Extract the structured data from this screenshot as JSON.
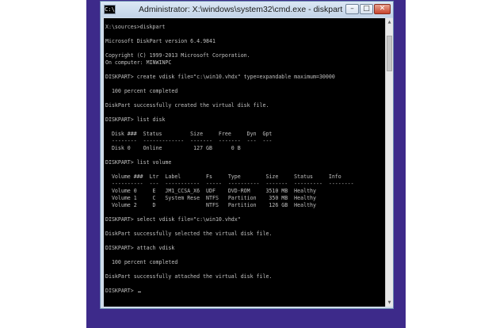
{
  "window": {
    "title": "Administrator: X:\\windows\\system32\\cmd.exe - diskpart",
    "icon_name": "cmd-prompt-icon",
    "icon_glyph": "C:\\",
    "minimize_glyph": "–",
    "maximize_glyph": "□",
    "close_glyph": "✕"
  },
  "console": {
    "foreground_color": "#c0c0c0",
    "background_color": "#000000",
    "lines": [
      "X:\\sources>diskpart",
      "",
      "Microsoft DiskPart version 6.4.9841",
      "",
      "Copyright (C) 1999-2013 Microsoft Corporation.",
      "On computer: MINWINPC",
      "",
      "DISKPART> create vdisk file=\"c:\\win10.vhdx\" type=expandable maximum=30000",
      "",
      "  100 percent completed",
      "",
      "DiskPart successfully created the virtual disk file.",
      "",
      "DISKPART> list disk",
      "",
      "  Disk ###  Status         Size     Free     Dyn  Gpt",
      "  --------  -------------  -------  -------  ---  ---",
      "  Disk 0    Online          127 GB      0 B",
      "",
      "DISKPART> list volume",
      "",
      "  Volume ###  Ltr  Label        Fs     Type        Size     Status     Info",
      "  ----------  ---  -----------  -----  ----------  -------  ---------  --------",
      "  Volume 0     E   JM1_CCSA_X6  UDF    DVD-ROM     3510 MB  Healthy",
      "  Volume 1     C   System Rese  NTFS   Partition    350 MB  Healthy",
      "  Volume 2     D                NTFS   Partition    126 GB  Healthy",
      "",
      "DISKPART> select vdisk file=\"c:\\win10.vhdx\"",
      "",
      "DiskPart successfully selected the virtual disk file.",
      "",
      "DISKPART> attach vdisk",
      "",
      "  100 percent completed",
      "",
      "DiskPart successfully attached the virtual disk file.",
      "",
      "DISKPART> "
    ]
  },
  "scrollbar": {
    "up_glyph": "▲",
    "down_glyph": "▼",
    "position_fraction": 0.04,
    "thumb_fraction": 0.13
  },
  "colors": {
    "desktop_background": "#3d2a8a",
    "window_frame": "#cfdcea",
    "close_button": "#c8452e"
  }
}
